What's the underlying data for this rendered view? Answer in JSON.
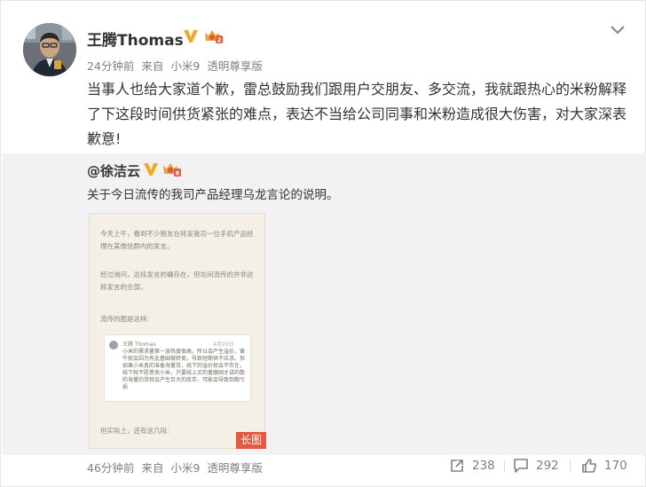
{
  "post": {
    "author": "王腾Thomas",
    "meta": {
      "time": "24分钟前",
      "from": "来自",
      "device": "小米9",
      "edition": "透明尊享版"
    },
    "text": "当事人也给大家道个歉，雷总鼓励我们跟用户交朋友、多交流，我就跟热心的米粉解释了下这段时间供货紧张的难点，表达不当给公司同事和米粉造成很大伤害，对大家深表歉意!"
  },
  "repost": {
    "author": "@徐洁云",
    "text": "关于今日流传的我司产品经理乌龙言论的说明。",
    "image": {
      "para1": "今天上午，看到不少朋友在转发我司一位手机产品经理在某微信群内的发言。",
      "para2": "经过询问，这段发言的确存在，但坊间流传的并非这段发言的全部。",
      "para3": "流传的图是这样:",
      "shot_name": "王腾 Thomas",
      "shot_time": "4月20日",
      "shot_text": "小米的需求量第一波热度很高，所以会产生溢价，黄牛就会因为有此基础做转卖，导致短期供不应求。但如果小米真的准备海量货，线下的溢价就会不存在，线下就不愿意卖小米，只要线上买的量跟刚才讲的数的海量的货就会产生巨大的库存，可能会导致到期亏损",
      "para4": "但实际上，还有这几段:",
      "badge": "长图"
    }
  },
  "footer": {
    "meta": {
      "time": "46分钟前",
      "from": "来自",
      "device": "小米9",
      "edition": "透明尊享版"
    },
    "reposts": "238",
    "comments": "292",
    "likes": "170"
  },
  "colors": {
    "accent_orange": "#f5a623",
    "badge_red": "#e8583f",
    "repost_bg": "#f2f2f5"
  },
  "icons": [
    "avatar-photo",
    "verified-v-icon",
    "vip-crown-icon",
    "chevron-down-icon",
    "repost-icon",
    "comment-icon",
    "like-icon"
  ]
}
